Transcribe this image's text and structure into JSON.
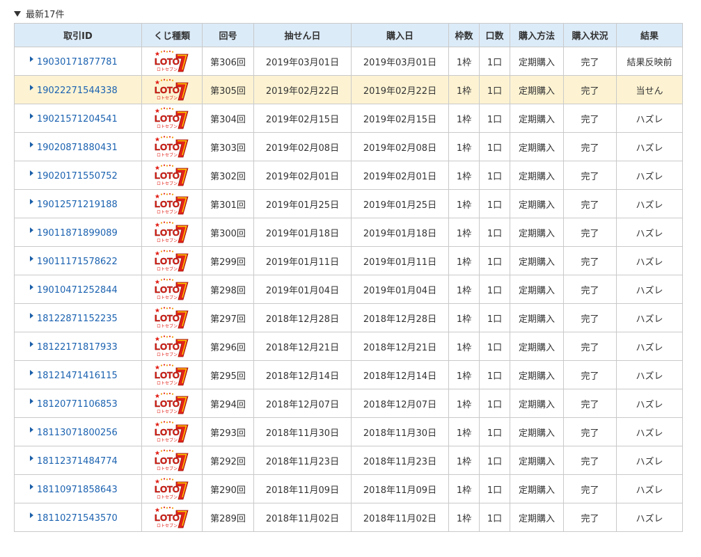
{
  "section": {
    "collapse_icon": "triangle-down-icon",
    "title": "最新17件"
  },
  "table": {
    "columns": [
      "取引ID",
      "くじ種類",
      "回号",
      "抽せん日",
      "購入日",
      "枠数",
      "口数",
      "購入方法",
      "購入状況",
      "結果"
    ],
    "lottery_logo": {
      "name": "loto7-logo-icon",
      "main_text": "LOTO",
      "numeral": "7",
      "sub_text": "ロトセブン",
      "colors": {
        "red": "#e2231a",
        "orange": "#f39800",
        "yellow": "#ffd200"
      }
    },
    "colors": {
      "header_bg": "#dcebf8",
      "highlight_bg": "#fdf3d3",
      "link": "#1b62b0",
      "border": "#c9c9c9"
    },
    "rows": [
      {
        "id": "19030171877781",
        "round": "第306回",
        "draw_date": "2019年03月01日",
        "purchase_date": "2019年03月01日",
        "frames": "1枠",
        "units": "1口",
        "method": "定期購入",
        "status": "完了",
        "result": "結果反映前",
        "highlight": false
      },
      {
        "id": "19022271544338",
        "round": "第305回",
        "draw_date": "2019年02月22日",
        "purchase_date": "2019年02月22日",
        "frames": "1枠",
        "units": "1口",
        "method": "定期購入",
        "status": "完了",
        "result": "当せん",
        "highlight": true
      },
      {
        "id": "19021571204541",
        "round": "第304回",
        "draw_date": "2019年02月15日",
        "purchase_date": "2019年02月15日",
        "frames": "1枠",
        "units": "1口",
        "method": "定期購入",
        "status": "完了",
        "result": "ハズレ",
        "highlight": false
      },
      {
        "id": "19020871880431",
        "round": "第303回",
        "draw_date": "2019年02月08日",
        "purchase_date": "2019年02月08日",
        "frames": "1枠",
        "units": "1口",
        "method": "定期購入",
        "status": "完了",
        "result": "ハズレ",
        "highlight": false
      },
      {
        "id": "19020171550752",
        "round": "第302回",
        "draw_date": "2019年02月01日",
        "purchase_date": "2019年02月01日",
        "frames": "1枠",
        "units": "1口",
        "method": "定期購入",
        "status": "完了",
        "result": "ハズレ",
        "highlight": false
      },
      {
        "id": "19012571219188",
        "round": "第301回",
        "draw_date": "2019年01月25日",
        "purchase_date": "2019年01月25日",
        "frames": "1枠",
        "units": "1口",
        "method": "定期購入",
        "status": "完了",
        "result": "ハズレ",
        "highlight": false
      },
      {
        "id": "19011871899089",
        "round": "第300回",
        "draw_date": "2019年01月18日",
        "purchase_date": "2019年01月18日",
        "frames": "1枠",
        "units": "1口",
        "method": "定期購入",
        "status": "完了",
        "result": "ハズレ",
        "highlight": false
      },
      {
        "id": "19011171578622",
        "round": "第299回",
        "draw_date": "2019年01月11日",
        "purchase_date": "2019年01月11日",
        "frames": "1枠",
        "units": "1口",
        "method": "定期購入",
        "status": "完了",
        "result": "ハズレ",
        "highlight": false
      },
      {
        "id": "19010471252844",
        "round": "第298回",
        "draw_date": "2019年01月04日",
        "purchase_date": "2019年01月04日",
        "frames": "1枠",
        "units": "1口",
        "method": "定期購入",
        "status": "完了",
        "result": "ハズレ",
        "highlight": false
      },
      {
        "id": "18122871152235",
        "round": "第297回",
        "draw_date": "2018年12月28日",
        "purchase_date": "2018年12月28日",
        "frames": "1枠",
        "units": "1口",
        "method": "定期購入",
        "status": "完了",
        "result": "ハズレ",
        "highlight": false
      },
      {
        "id": "18122171817933",
        "round": "第296回",
        "draw_date": "2018年12月21日",
        "purchase_date": "2018年12月21日",
        "frames": "1枠",
        "units": "1口",
        "method": "定期購入",
        "status": "完了",
        "result": "ハズレ",
        "highlight": false
      },
      {
        "id": "18121471416115",
        "round": "第295回",
        "draw_date": "2018年12月14日",
        "purchase_date": "2018年12月14日",
        "frames": "1枠",
        "units": "1口",
        "method": "定期購入",
        "status": "完了",
        "result": "ハズレ",
        "highlight": false
      },
      {
        "id": "18120771106853",
        "round": "第294回",
        "draw_date": "2018年12月07日",
        "purchase_date": "2018年12月07日",
        "frames": "1枠",
        "units": "1口",
        "method": "定期購入",
        "status": "完了",
        "result": "ハズレ",
        "highlight": false
      },
      {
        "id": "18113071800256",
        "round": "第293回",
        "draw_date": "2018年11月30日",
        "purchase_date": "2018年11月30日",
        "frames": "1枠",
        "units": "1口",
        "method": "定期購入",
        "status": "完了",
        "result": "ハズレ",
        "highlight": false
      },
      {
        "id": "18112371484774",
        "round": "第292回",
        "draw_date": "2018年11月23日",
        "purchase_date": "2018年11月23日",
        "frames": "1枠",
        "units": "1口",
        "method": "定期購入",
        "status": "完了",
        "result": "ハズレ",
        "highlight": false
      },
      {
        "id": "18110971858643",
        "round": "第290回",
        "draw_date": "2018年11月09日",
        "purchase_date": "2018年11月09日",
        "frames": "1枠",
        "units": "1口",
        "method": "定期購入",
        "status": "完了",
        "result": "ハズレ",
        "highlight": false
      },
      {
        "id": "18110271543570",
        "round": "第289回",
        "draw_date": "2018年11月02日",
        "purchase_date": "2018年11月02日",
        "frames": "1枠",
        "units": "1口",
        "method": "定期購入",
        "status": "完了",
        "result": "ハズレ",
        "highlight": false
      }
    ]
  }
}
